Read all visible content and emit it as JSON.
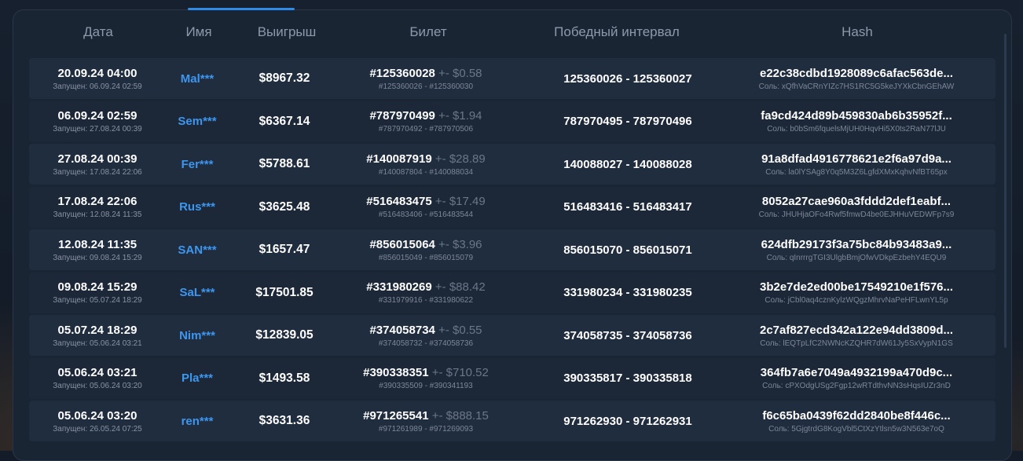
{
  "colors": {
    "accent": "#3d96f0",
    "panel": "#1a2534",
    "row": "#202d3f",
    "muted": "#8d99ab"
  },
  "header": {
    "date": "Дата",
    "name": "Имя",
    "win": "Выигрыш",
    "ticket": "Билет",
    "interval": "Победный интервал",
    "hash": "Hash"
  },
  "rows": [
    {
      "date": "20.09.24 04:00",
      "started": "Запущен: 06.09.24 02:59",
      "name": "Mal***",
      "win": "$8967.32",
      "ticket": "#125360028",
      "tolerance": "+- $0.58",
      "ticket_range": "#125360026 - #125360030",
      "interval": "125360026 - 125360027",
      "hash": "e22c38cdbd1928089c6afac563de...",
      "salt": "Соль: xQfhVaCRnYIZc7HS1RC5G5keJYXkCbnGEhAW"
    },
    {
      "date": "06.09.24 02:59",
      "started": "Запущен: 27.08.24 00:39",
      "name": "Sem***",
      "win": "$6367.14",
      "ticket": "#787970499",
      "tolerance": "+- $1.94",
      "ticket_range": "#787970492 - #787970506",
      "interval": "787970495 - 787970496",
      "hash": "fa9cd424d89b459830ab6b35952f...",
      "salt": "Соль: b0bSm6fquelsMjUH0HqvHi5X0ts2RaN77lJU"
    },
    {
      "date": "27.08.24 00:39",
      "started": "Запущен: 17.08.24 22:06",
      "name": "Fer***",
      "win": "$5788.61",
      "ticket": "#140087919",
      "tolerance": "+- $28.89",
      "ticket_range": "#140087804 - #140088034",
      "interval": "140088027 - 140088028",
      "hash": "91a8dfad4916778621e2f6a97d9a...",
      "salt": "Соль: la0lYSAg8Y0q5M3Z6LgfdXMxKqhvNfBT65px"
    },
    {
      "date": "17.08.24 22:06",
      "started": "Запущен: 12.08.24 11:35",
      "name": "Rus***",
      "win": "$3625.48",
      "ticket": "#516483475",
      "tolerance": "+- $17.49",
      "ticket_range": "#516483406 - #516483544",
      "interval": "516483416 - 516483417",
      "hash": "8052a27cae960a3fddd2def1eabf...",
      "salt": "Соль: JHUHjaOFo4Rwf5fmwD4be0EJHHuVEDWFp7s9"
    },
    {
      "date": "12.08.24 11:35",
      "started": "Запущен: 09.08.24 15:29",
      "name": "SAN***",
      "win": "$1657.47",
      "ticket": "#856015064",
      "tolerance": "+- $3.96",
      "ticket_range": "#856015049 - #856015079",
      "interval": "856015070 - 856015071",
      "hash": "624dfb29173f3a75bc84b93483a9...",
      "salt": "Соль: qInrrrgTGI3UlgbBmjOfwVDkpEzbehY4EQU9"
    },
    {
      "date": "09.08.24 15:29",
      "started": "Запущен: 05.07.24 18:29",
      "name": "SaL***",
      "win": "$17501.85",
      "ticket": "#331980269",
      "tolerance": "+- $88.42",
      "ticket_range": "#331979916 - #331980622",
      "interval": "331980234 - 331980235",
      "hash": "3b2e7de2ed00be17549210e1f576...",
      "salt": "Соль: jCbl0aq4cznKylzWQgzMhrvNaPeHFLwnYL5p"
    },
    {
      "date": "05.07.24 18:29",
      "started": "Запущен: 05.06.24 03:21",
      "name": "Nim***",
      "win": "$12839.05",
      "ticket": "#374058734",
      "tolerance": "+- $0.55",
      "ticket_range": "#374058732 - #374058736",
      "interval": "374058735 - 374058736",
      "hash": "2c7af827ecd342a122e94dd3809d...",
      "salt": "Соль: lEQTpLfC2NWNcKZQHR7dW61Jy5SxVypN1GS"
    },
    {
      "date": "05.06.24 03:21",
      "started": "Запущен: 05.06.24 03:20",
      "name": "Pla***",
      "win": "$1493.58",
      "ticket": "#390338351",
      "tolerance": "+- $710.52",
      "ticket_range": "#390335509 - #390341193",
      "interval": "390335817 - 390335818",
      "hash": "364fb7a6e7049a4932199a470d9c...",
      "salt": "Соль: cPXOdgUSg2Fgp12wRTdthvNN3sHqsIUZr3nD"
    },
    {
      "date": "05.06.24 03:20",
      "started": "Запущен: 26.05.24 07:25",
      "name": "ren***",
      "win": "$3631.36",
      "ticket": "#971265541",
      "tolerance": "+- $888.15",
      "ticket_range": "#971261989 - #971269093",
      "interval": "971262930 - 971262931",
      "hash": "f6c65ba0439f62dd2840be8f446c...",
      "salt": "Соль: 5GjgtrdG8KogVbl5CtXzYtlsn5w3N563e7oQ"
    }
  ]
}
